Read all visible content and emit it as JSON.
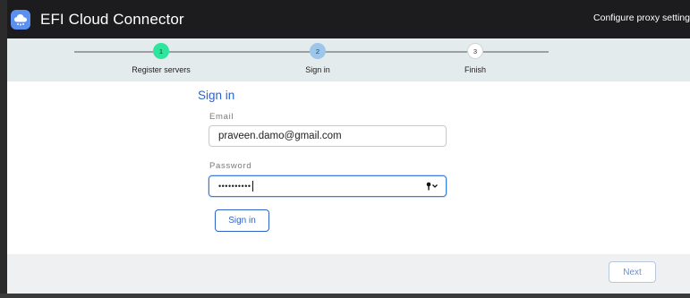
{
  "window": {
    "title": "EFI Cloud Connector",
    "proxy_link": "Configure proxy setting"
  },
  "stepper": {
    "steps": [
      {
        "number": "1",
        "label": "Register servers",
        "state": "complete",
        "color": "#2ee59d"
      },
      {
        "number": "2",
        "label": "Sign in",
        "state": "current",
        "color": "#9dc7ea"
      },
      {
        "number": "3",
        "label": "Finish",
        "state": "pending",
        "color": "#ffffff"
      }
    ]
  },
  "form": {
    "title": "Sign in",
    "email_label": "Email",
    "email_value": "praveen.damo@gmail.com",
    "password_label": "Password",
    "password_value": "••••••••••",
    "password_icon": "key-icon",
    "submit_label": "Sign in"
  },
  "footer": {
    "next_label": "Next"
  },
  "colors": {
    "accent": "#2f62c9",
    "titlebar": "#1c1c1e",
    "stepper_bg": "#e4ebed"
  }
}
